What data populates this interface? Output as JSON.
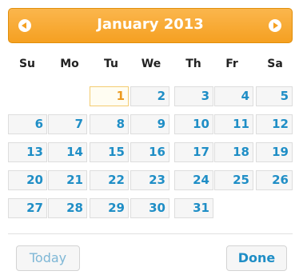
{
  "header": {
    "title": "January 2013"
  },
  "weekdays": [
    "Su",
    "Mo",
    "Tu",
    "We",
    "Th",
    "Fr",
    "Sa"
  ],
  "weeks": [
    [
      "",
      "",
      "1",
      "2",
      "3",
      "4",
      "5"
    ],
    [
      "6",
      "7",
      "8",
      "9",
      "10",
      "11",
      "12"
    ],
    [
      "13",
      "14",
      "15",
      "16",
      "17",
      "18",
      "19"
    ],
    [
      "20",
      "21",
      "22",
      "23",
      "24",
      "25",
      "26"
    ],
    [
      "27",
      "28",
      "29",
      "30",
      "31",
      "",
      ""
    ]
  ],
  "highlighted_day": "1",
  "buttons": {
    "today": "Today",
    "done": "Done"
  },
  "colors": {
    "accent": "#f5a021",
    "link": "#1f8ec6",
    "highlight": "#ec9a1f"
  }
}
